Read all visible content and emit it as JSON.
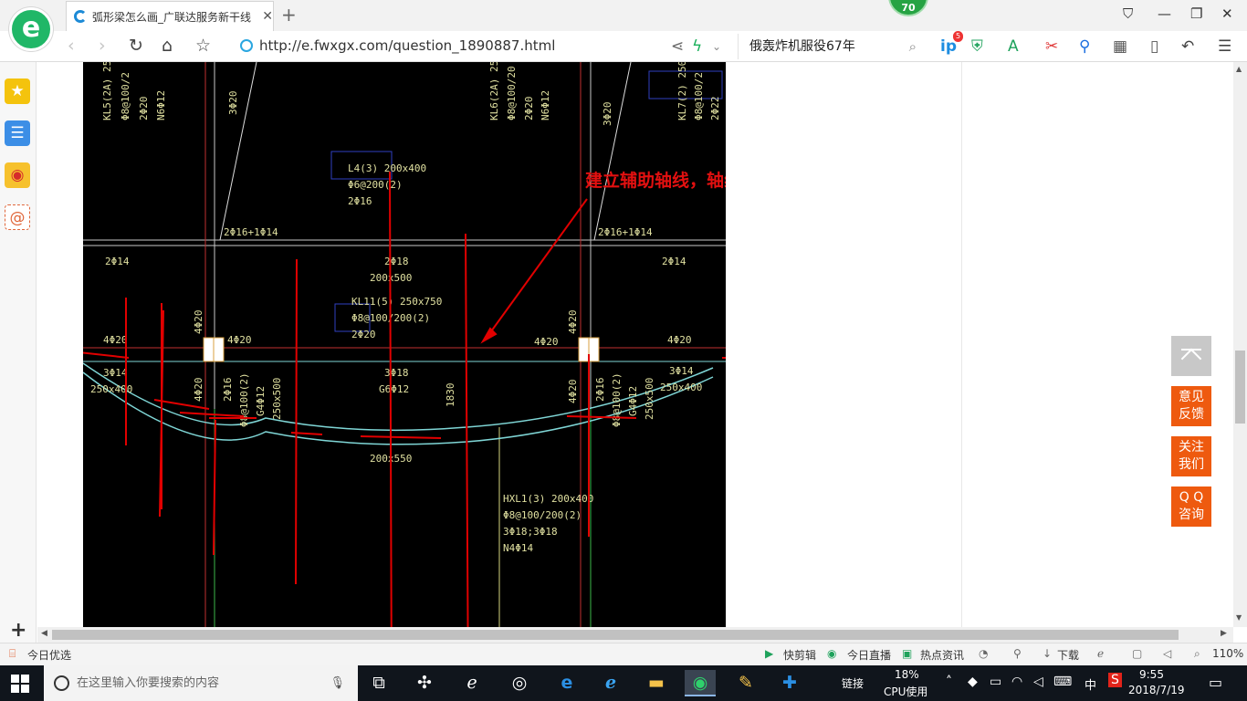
{
  "browser": {
    "tab_title": "弧形梁怎么画_广联达服务新干线",
    "new_tab_symbol": "+",
    "score_badge": "70",
    "address": "http://e.fwxgx.com/question_1890887.html",
    "search_text": "俄轰炸机服役67年",
    "badge_count": "5"
  },
  "sidebar": {
    "items": [
      {
        "name": "favorites",
        "icon": "star-icon"
      },
      {
        "name": "reader",
        "icon": "list-icon"
      },
      {
        "name": "weibo",
        "icon": "weibo-icon"
      },
      {
        "name": "mail",
        "icon": "mail-icon"
      }
    ],
    "add_symbol": "+"
  },
  "cad": {
    "annotation": "建立辅助轴线，轴线，三点画弧绘制",
    "labels": {
      "kl5": "KL5(2A) 25",
      "kl5_2": "Φ8@100/2",
      "kl5_3": "2Φ20",
      "kl5_4": "N6Φ12",
      "kl6": "KL6(2A) 25",
      "kl6_2": "Φ8@100/20",
      "kl6_3": "2Φ20",
      "kl6_4": "N6Φ12",
      "kl7": "KL7(2) 250x",
      "kl7_2": "Φ8@100/2",
      "kl7_3": "2Φ22",
      "top_3phi20_l": "3Φ20",
      "top_3phi20_r": "3Φ20",
      "l4": "L4(3) 200x400",
      "l4_2": "Φ6@200(2)",
      "l4_3": "2Φ16",
      "bar_2phi16_l": "2Φ16+1Φ14",
      "bar_2phi16_r": "2Φ16+1Φ14",
      "bar_2phi14_l": "2Φ14",
      "bar_2phi14_r": "2Φ14",
      "bar_2phi18": "2Φ18",
      "size_200x500": "200x500",
      "kl11": "KL11(5) 250x750",
      "kl11_2": "Φ8@100/200(2)",
      "kl11_3": "2Φ20",
      "phi20_a": "4Φ20",
      "phi20_b": "4Φ20",
      "phi20_c": "4Φ20",
      "phi20_d": "4Φ20",
      "phi20_v1": "4Φ20",
      "phi20_v2": "4Φ20",
      "phi20_v3": "4Φ20",
      "phi20_v4": "4Φ20",
      "left_3phi14": "3Φ14",
      "left_size": "250x400",
      "right_3phi14": "3Φ14",
      "right_size": "250x400",
      "mid_3phi18": "3Φ18",
      "mid_g": "G6Φ12",
      "dim_1830": "1830",
      "size_200x550": "200x550",
      "v_2phi16_l": "2Φ16",
      "v_phi8_l": "Φ8@100(2)",
      "v_g4_l": "G4Φ12",
      "v_size_l": "250x500",
      "v_2phi16_r": "2Φ16",
      "v_phi8_r": "Φ8@100(2)",
      "v_g4_r": "G4Φ12",
      "v_size_r": "250x500",
      "hxl": "HXL1(3) 200x400",
      "hxl_2": "Φ8@100/200(2)",
      "hxl_3": "3Φ18;3Φ18",
      "hxl_4": "N4Φ14"
    }
  },
  "float_buttons": {
    "feedback": "意见\n反馈",
    "follow": "关注\n我们",
    "qq": "Q Q\n咨询"
  },
  "statusbar": {
    "left": "今日优选",
    "kuaijianji": "快剪辑",
    "live": "今日直播",
    "news": "热点资讯",
    "download": "下载",
    "zoom": "110%"
  },
  "taskbar": {
    "search_placeholder": "在这里输入你要搜索的内容",
    "links": "链接",
    "cpu_percent": "18%",
    "cpu_label": "CPU使用",
    "ime": "中",
    "time": "9:55",
    "date": "2018/7/19"
  }
}
